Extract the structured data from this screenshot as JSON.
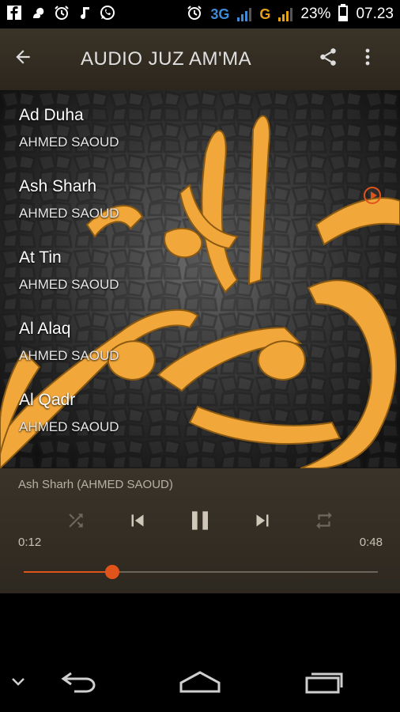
{
  "status_bar": {
    "left_icons": [
      "facebook-icon",
      "squirrel-app-icon",
      "alarm-icon",
      "music-note-icon",
      "whatsapp-icon"
    ],
    "right": {
      "alarm": "alarm-icon",
      "network1": "3G",
      "network2": "G",
      "battery_percent": "23%",
      "time": "07.23"
    }
  },
  "app_bar": {
    "title": "AUDIO JUZ AM'MA",
    "back_icon": "arrow-back-icon",
    "share_icon": "share-icon",
    "menu_icon": "more-vert-icon"
  },
  "tracks": [
    {
      "title": "Ad Duha",
      "artist": "AHMED SAOUD",
      "playing": false
    },
    {
      "title": "Ash Sharh",
      "artist": "AHMED SAOUD",
      "playing": true
    },
    {
      "title": "At Tin",
      "artist": "AHMED SAOUD",
      "playing": false
    },
    {
      "title": "Al Alaq",
      "artist": "AHMED SAOUD",
      "playing": false
    },
    {
      "title": "Al Qadr",
      "artist": "AHMED SAOUD",
      "playing": false
    }
  ],
  "player": {
    "now_playing": "Ash Sharh (AHMED SAOUD)",
    "elapsed": "0:12",
    "duration": "0:48",
    "progress_fraction": 0.25,
    "controls": [
      "shuffle-icon",
      "skip-previous-icon",
      "pause-icon",
      "skip-next-icon",
      "repeat-icon"
    ]
  },
  "colors": {
    "accent": "#e0541b",
    "app_bar": "#3a3327",
    "calligraphy": "#f0a83a"
  },
  "nav_bar": [
    "chevron-down-icon",
    "back-icon",
    "home-icon",
    "recents-icon"
  ]
}
